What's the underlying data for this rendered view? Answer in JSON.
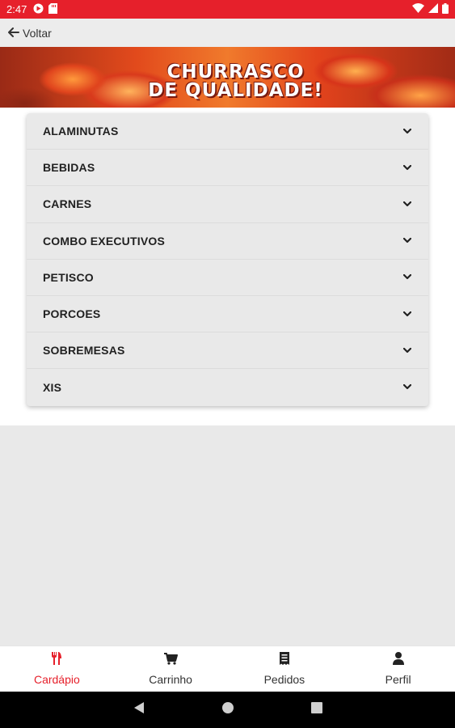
{
  "status_bar": {
    "time": "2:47",
    "icons": [
      "google-play-icon",
      "sd-card-icon",
      "wifi-icon",
      "signal-icon",
      "battery-icon"
    ]
  },
  "top_bar": {
    "back_label": "Voltar",
    "back_icon": "arrow-left-icon"
  },
  "banner": {
    "line1": "CHURRASCO",
    "line2": "DE QUALIDADE!"
  },
  "menu": {
    "categories": [
      {
        "label": "ALAMINUTAS"
      },
      {
        "label": "BEBIDAS"
      },
      {
        "label": "CARNES"
      },
      {
        "label": "COMBO EXECUTIVOS"
      },
      {
        "label": "PETISCO"
      },
      {
        "label": "PORCOES"
      },
      {
        "label": "SOBREMESAS"
      },
      {
        "label": "XIS"
      }
    ]
  },
  "bottom_nav": {
    "items": [
      {
        "label": "Cardápio",
        "icon": "utensils-icon",
        "active": true
      },
      {
        "label": "Carrinho",
        "icon": "cart-icon",
        "active": false
      },
      {
        "label": "Pedidos",
        "icon": "receipt-icon",
        "active": false
      },
      {
        "label": "Perfil",
        "icon": "user-icon",
        "active": false
      }
    ]
  },
  "colors": {
    "accent": "#e6202b",
    "text": "#212121",
    "background": "#e9e9e9"
  }
}
